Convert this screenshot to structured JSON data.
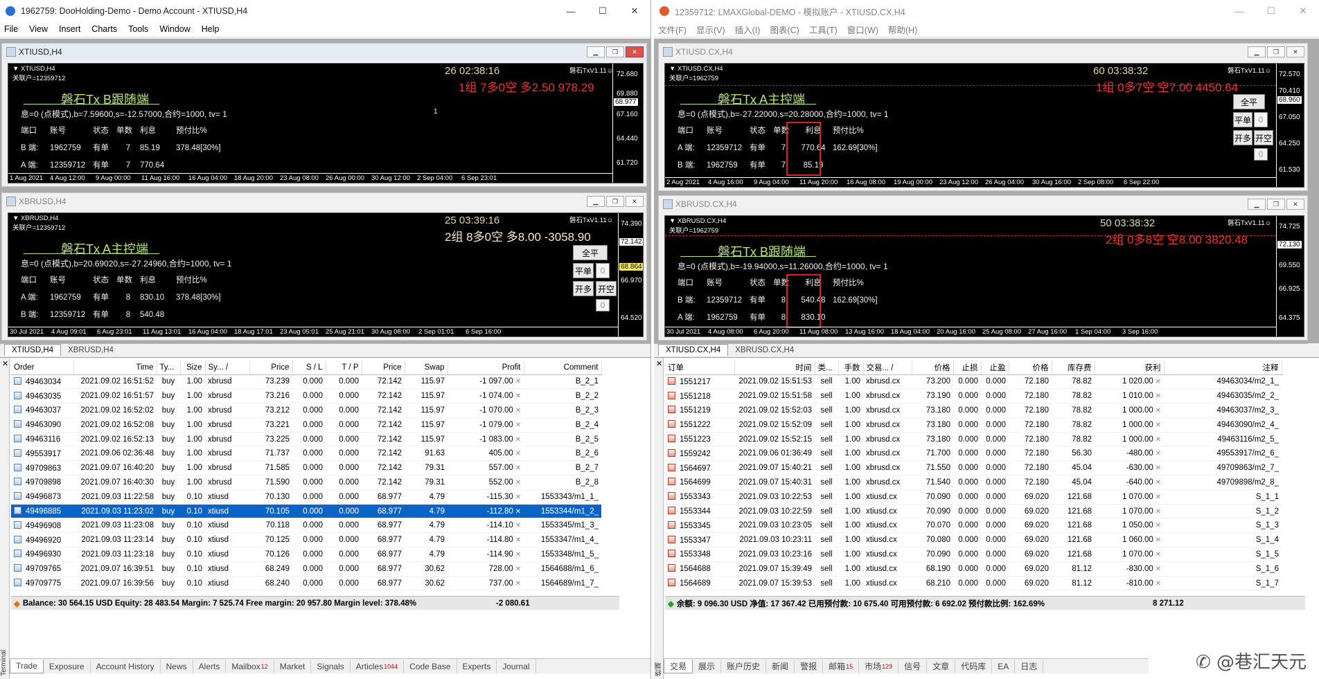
{
  "left": {
    "title": "1962759: DooHolding-Demo - Demo Account - XTIUSD,H4",
    "title_controls": [
      "—",
      "☐",
      "✕"
    ],
    "menu": [
      "File",
      "View",
      "Insert",
      "Charts",
      "Tools",
      "Window",
      "Help"
    ],
    "chart1": {
      "window_title": "XTIUSD,H4",
      "symbol": "▼ XTIUSD,H4",
      "account": "关联户=12359712",
      "version": "磐石TxV1.11☺",
      "timer": "26    02:38:16",
      "summary": "1组 7多0空 多2.50 978.29",
      "title_text": "磐石Tx B跟随端",
      "params": "息=0 (点模式),b=7.59600,s=-12.57000,合约=1000, tv= 1",
      "hdr": {
        "c1": "端口",
        "c2": "账号",
        "c3": "状态",
        "c4": "单数",
        "c5": "利息",
        "c6": "预付比%"
      },
      "row1": {
        "c1": "B 端:",
        "c2": "1962759",
        "c3": "有单",
        "c4": "7",
        "c5": "85.19",
        "c6": "378.48[30%]"
      },
      "row2": {
        "c1": "A 端:",
        "c2": "12359712",
        "c3": "有单",
        "c4": "7",
        "c5": "770.64"
      },
      "mark": "1",
      "prices": [
        "72.680",
        "69.880",
        "68.977",
        "67.160",
        "64.440",
        "61.720"
      ],
      "dates": [
        "1 Aug 2021",
        "4 Aug 12:00",
        "9 Aug 00:00",
        "11 Aug 16:00",
        "16 Aug 04:00",
        "18 Aug 20:00",
        "23 Aug 08:00",
        "26 Aug 00:00",
        "30 Aug 12:00",
        "2 Sep 04:00",
        "6 Sep 23:01"
      ]
    },
    "chart2": {
      "window_title": "XBRUSD,H4",
      "symbol": "▼ XBRUSD,H4",
      "account": "关联户=12359712",
      "version": "磐石TxV1.11☺",
      "timer": "25    03:39:16",
      "summary": "2组 8多0空 多8.00 -3058.90",
      "title_text": "磐石Tx A主控端",
      "params": "息=0 (点模式),b=20.69020,s=-27.24960,合约=1000, tv= 1",
      "hdr": {
        "c1": "端口",
        "c2": "账号",
        "c3": "状态",
        "c4": "单数",
        "c5": "利息",
        "c6": "预付比%"
      },
      "row1": {
        "c1": "A 端:",
        "c2": "1962759",
        "c3": "有单",
        "c4": "8",
        "c5": "830.10",
        "c6": "378.48[30%]"
      },
      "row2": {
        "c1": "B 端:",
        "c2": "12359712",
        "c3": "有单",
        "c4": "8",
        "c5": "540.48"
      },
      "prices": [
        "74.390",
        "72.142",
        "68.864",
        "66.970",
        "64.520"
      ],
      "dates": [
        "30 Jul 2021",
        "4 Aug 09:01",
        "6 Aug 23:01",
        "11 Aug 13:01",
        "16 Aug 04:00",
        "18 Aug 17:01",
        "23 Aug 05:01",
        "25 Aug 21:01",
        "30 Aug 08:00",
        "2 Sep 01:01",
        "6 Sep 16:00"
      ],
      "btn_all": "全平",
      "btn_flat": "平单",
      "btn_zero": "0",
      "btn_long": "开多",
      "btn_short": "开空"
    },
    "chart_tabs": [
      "XTIUSD,H4",
      "XBRUSD,H4"
    ],
    "terminal": {
      "side_label": "Terminal",
      "headers": [
        "Order",
        "Time",
        "Ty...",
        "Size",
        "Sy... /",
        "Price",
        "S / L",
        "T / P",
        "Price",
        "Swap",
        "Profit",
        "Comment"
      ],
      "rows": [
        [
          "49463034",
          "2021.09.02 16:51:52",
          "buy",
          "1.00",
          "xbrusd",
          "73.239",
          "0.000",
          "0.000",
          "72.142",
          "115.97",
          "-1 097.00",
          "B_2_1"
        ],
        [
          "49463035",
          "2021.09.02 16:51:57",
          "buy",
          "1.00",
          "xbrusd",
          "73.216",
          "0.000",
          "0.000",
          "72.142",
          "115.97",
          "-1 074.00",
          "B_2_2"
        ],
        [
          "49463037",
          "2021.09.02 16:52:02",
          "buy",
          "1.00",
          "xbrusd",
          "73.212",
          "0.000",
          "0.000",
          "72.142",
          "115.97",
          "-1 070.00",
          "B_2_3"
        ],
        [
          "49463090",
          "2021.09.02 16:52:08",
          "buy",
          "1.00",
          "xbrusd",
          "73.221",
          "0.000",
          "0.000",
          "72.142",
          "115.97",
          "-1 079.00",
          "B_2_4"
        ],
        [
          "49463116",
          "2021.09.02 16:52:13",
          "buy",
          "1.00",
          "xbrusd",
          "73.225",
          "0.000",
          "0.000",
          "72.142",
          "115.97",
          "-1 083.00",
          "B_2_5"
        ],
        [
          "49553917",
          "2021.09.06 02:36:48",
          "buy",
          "1.00",
          "xbrusd",
          "71.737",
          "0.000",
          "0.000",
          "72.142",
          "91.63",
          "405.00",
          "B_2_6"
        ],
        [
          "49709863",
          "2021.09.07 16:40:20",
          "buy",
          "1.00",
          "xbrusd",
          "71.585",
          "0.000",
          "0.000",
          "72.142",
          "79.31",
          "557.00",
          "B_2_7"
        ],
        [
          "49709898",
          "2021.09.07 16:40:30",
          "buy",
          "1.00",
          "xbrusd",
          "71.590",
          "0.000",
          "0.000",
          "72.142",
          "79.31",
          "552.00",
          "B_2_8"
        ],
        [
          "49496873",
          "2021.09.03 11:22:58",
          "buy",
          "0.10",
          "xtiusd",
          "70.130",
          "0.000",
          "0.000",
          "68.977",
          "4.79",
          "-115.30",
          "1553343/m1_1_"
        ],
        [
          "49496885",
          "2021.09.03 11:23:02",
          "buy",
          "0.10",
          "xtiusd",
          "70.105",
          "0.000",
          "0.000",
          "68.977",
          "4.79",
          "-112.80",
          "1553344/m1_2_"
        ],
        [
          "49496908",
          "2021.09.03 11:23:08",
          "buy",
          "0.10",
          "xtiusd",
          "70.118",
          "0.000",
          "0.000",
          "68.977",
          "4.79",
          "-114.10",
          "1553345/m1_3_"
        ],
        [
          "49496920",
          "2021.09.03 11:23:14",
          "buy",
          "0.10",
          "xtiusd",
          "70.125",
          "0.000",
          "0.000",
          "68.977",
          "4.79",
          "-114.80",
          "1553347/m1_4_"
        ],
        [
          "49496930",
          "2021.09.03 11:23:18",
          "buy",
          "0.10",
          "xtiusd",
          "70.126",
          "0.000",
          "0.000",
          "68.977",
          "4.79",
          "-114.90",
          "1553348/m1_5_"
        ],
        [
          "49709765",
          "2021.09.07 16:39:51",
          "buy",
          "0.10",
          "xtiusd",
          "68.249",
          "0.000",
          "0.000",
          "68.977",
          "30.62",
          "728.00",
          "1564688/m1_6_"
        ],
        [
          "49709775",
          "2021.09.07 16:39:56",
          "buy",
          "0.10",
          "xtiusd",
          "68.240",
          "0.000",
          "0.000",
          "68.977",
          "30.62",
          "737.00",
          "1564689/m1_7_"
        ]
      ],
      "selected_row": 9,
      "balance_line": "Balance: 30 564.15 USD  Equity: 28 483.54  Margin: 7 525.74  Free margin: 20 957.80  Margin level: 378.48%",
      "balance_profit": "-2 080.61",
      "tabs": [
        {
          "label": "Trade",
          "badge": ""
        },
        {
          "label": "Exposure",
          "badge": ""
        },
        {
          "label": "Account History",
          "badge": ""
        },
        {
          "label": "News",
          "badge": ""
        },
        {
          "label": "Alerts",
          "badge": ""
        },
        {
          "label": "Mailbox",
          "badge": "12"
        },
        {
          "label": "Market",
          "badge": ""
        },
        {
          "label": "Signals",
          "badge": ""
        },
        {
          "label": "Articles",
          "badge": "1044"
        },
        {
          "label": "Code Base",
          "badge": ""
        },
        {
          "label": "Experts",
          "badge": ""
        },
        {
          "label": "Journal",
          "badge": ""
        }
      ]
    }
  },
  "right": {
    "title": "12359712: LMAXGlobal-DEMO - 模拟账户 - XTIUSD.CX,H4",
    "title_controls": [
      "—",
      "☐",
      "✕"
    ],
    "menu": [
      "文件(F)",
      "显示(V)",
      "插入(I)",
      "图表(C)",
      "工具(T)",
      "窗口(W)",
      "帮助(H)"
    ],
    "chart1": {
      "window_title": "XTIUSD.CX,H4",
      "symbol": "▼ XTIUSD.CX,H4",
      "account": "关联户=1962759",
      "version": "磐石TxV1.11☺",
      "timer": "60    03:38:32",
      "summary": "1组 0多7空 空7.00 4450.64",
      "title_text": "磐石Tx A主控端",
      "params": "息=0 (点模式),b=-27.22000,s=20.28000,合约=1000, tv= 1",
      "hdr": {
        "c1": "端口",
        "c2": "账号",
        "c3": "状态",
        "c4": "单数",
        "c5": "利息",
        "c6": "预付比%"
      },
      "row1": {
        "c1": "A 端:",
        "c2": "12359712",
        "c3": "有单",
        "c4": "7",
        "c5": "770.64",
        "c6": "162.69[30%]"
      },
      "row2": {
        "c1": "B 端:",
        "c2": "1962759",
        "c3": "有单",
        "c4": "7",
        "c5": "85.19"
      },
      "prices": [
        "72.570",
        "70.410",
        "68.960",
        "67.050",
        "64.250",
        "61.530"
      ],
      "dates": [
        "2 Aug 2021",
        "4 Aug 16:00",
        "9 Aug 04:00",
        "11 Aug 20:00",
        "16 Aug 08:00",
        "19 Aug 00:00",
        "23 Aug 12:00",
        "26 Aug 04:00",
        "30 Aug 16:00",
        "2 Sep 08:00",
        "6 Sep 22:00"
      ],
      "btn_all": "全平",
      "btn_flat": "平单",
      "btn_zero": "0",
      "btn_long": "开多",
      "btn_short": "开空"
    },
    "chart2": {
      "window_title": "XBRUSD.CX,H4",
      "symbol": "▼ XBRUSD.CX,H4",
      "account": "关联户=1962759",
      "version": "磐石TxV1.11☺",
      "timer": "50    03:38:32",
      "summary": "2组 0多8空 空8.00 3820.48",
      "title_text": "磐石Tx B跟随端",
      "params": "息=0 (点模式),b=-19.94000,s=11.26000,合约=1000, tv= 1",
      "hdr": {
        "c1": "端口",
        "c2": "账号",
        "c3": "状态",
        "c4": "单数",
        "c5": "利息",
        "c6": "预付比%"
      },
      "row1": {
        "c1": "B 端:",
        "c2": "12359712",
        "c3": "有单",
        "c4": "8",
        "c5": "540.48",
        "c6": "162.69[30%]"
      },
      "row2": {
        "c1": "A 端:",
        "c2": "1962759",
        "c3": "有单",
        "c4": "8",
        "c5": "830.10"
      },
      "prices": [
        "74.725",
        "72.130",
        "69.550",
        "66.925",
        "64.375"
      ],
      "dates": [
        "30 Jul 2021",
        "4 Aug 08:00",
        "6 Aug 20:00",
        "11 Aug 08:00",
        "13 Aug 16:00",
        "18 Aug 04:00",
        "20 Aug 16:00",
        "25 Aug 08:00",
        "27 Aug 16:00",
        "1 Sep 04:00",
        "3 Sep 16:00"
      ]
    },
    "chart_tabs": [
      "XTIUSD.CX,H4",
      "XBRUSD.CX,H4"
    ],
    "terminal": {
      "side_label": "终端",
      "headers": [
        "订单",
        "时间",
        "类...",
        "手数",
        "交易... /",
        "价格",
        "止损",
        "止盈",
        "价格",
        "库存费",
        "获利",
        "注释"
      ],
      "rows": [
        [
          "1551217",
          "2021.09.02 15:51:53",
          "sell",
          "1.00",
          "xbrusd.cx",
          "73.200",
          "0.000",
          "0.000",
          "72.180",
          "78.82",
          "1 020.00",
          "49463034/m2_1_"
        ],
        [
          "1551218",
          "2021.09.02 15:51:58",
          "sell",
          "1.00",
          "xbrusd.cx",
          "73.190",
          "0.000",
          "0.000",
          "72.180",
          "78.82",
          "1 010.00",
          "49463035/m2_2_"
        ],
        [
          "1551219",
          "2021.09.02 15:52:03",
          "sell",
          "1.00",
          "xbrusd.cx",
          "73.180",
          "0.000",
          "0.000",
          "72.180",
          "78.82",
          "1 000.00",
          "49463037/m2_3_"
        ],
        [
          "1551222",
          "2021.09.02 15:52:09",
          "sell",
          "1.00",
          "xbrusd.cx",
          "73.180",
          "0.000",
          "0.000",
          "72.180",
          "78.82",
          "1 000.00",
          "49463090/m2_4_"
        ],
        [
          "1551223",
          "2021.09.02 15:52:15",
          "sell",
          "1.00",
          "xbrusd.cx",
          "73.180",
          "0.000",
          "0.000",
          "72.180",
          "78.82",
          "1 000.00",
          "49463116/m2_5_"
        ],
        [
          "1559242",
          "2021.09.06 01:36:49",
          "sell",
          "1.00",
          "xbrusd.cx",
          "71.700",
          "0.000",
          "0.000",
          "72.180",
          "56.30",
          "-480.00",
          "49553917/m2_6_"
        ],
        [
          "1564697",
          "2021.09.07 15:40:21",
          "sell",
          "1.00",
          "xbrusd.cx",
          "71.550",
          "0.000",
          "0.000",
          "72.180",
          "45.04",
          "-630.00",
          "49709863/m2_7_"
        ],
        [
          "1564699",
          "2021.09.07 15:40:31",
          "sell",
          "1.00",
          "xbrusd.cx",
          "71.540",
          "0.000",
          "0.000",
          "72.180",
          "45.04",
          "-640.00",
          "49709898/m2_8_"
        ],
        [
          "1553343",
          "2021.09.03 10:22:53",
          "sell",
          "1.00",
          "xtiusd.cx",
          "70.090",
          "0.000",
          "0.000",
          "69.020",
          "121.68",
          "1 070.00",
          "S_1_1"
        ],
        [
          "1553344",
          "2021.09.03 10:22:59",
          "sell",
          "1.00",
          "xtiusd.cx",
          "70.090",
          "0.000",
          "0.000",
          "69.020",
          "121.68",
          "1 070.00",
          "S_1_2"
        ],
        [
          "1553345",
          "2021.09.03 10:23:05",
          "sell",
          "1.00",
          "xtiusd.cx",
          "70.070",
          "0.000",
          "0.000",
          "69.020",
          "121.68",
          "1 050.00",
          "S_1_3"
        ],
        [
          "1553347",
          "2021.09.03 10:23:11",
          "sell",
          "1.00",
          "xtiusd.cx",
          "70.080",
          "0.000",
          "0.000",
          "69.020",
          "121.68",
          "1 060.00",
          "S_1_4"
        ],
        [
          "1553348",
          "2021.09.03 10:23:16",
          "sell",
          "1.00",
          "xtiusd.cx",
          "70.090",
          "0.000",
          "0.000",
          "69.020",
          "121.68",
          "1 070.00",
          "S_1_5"
        ],
        [
          "1564688",
          "2021.09.07 15:39:49",
          "sell",
          "1.00",
          "xtiusd.cx",
          "68.190",
          "0.000",
          "0.000",
          "69.020",
          "81.12",
          "-830.00",
          "S_1_6"
        ],
        [
          "1564689",
          "2021.09.07 15:39:53",
          "sell",
          "1.00",
          "xtiusd.cx",
          "68.210",
          "0.000",
          "0.000",
          "69.020",
          "81.12",
          "-810.00",
          "S_1_7"
        ]
      ],
      "balance_line": "余额: 9 096.30 USD  净值: 17 367.42  已用预付款: 10 675.40  可用预付款: 6 692.02  预付款比例: 162.69%",
      "balance_profit": "8 271.12",
      "tabs": [
        {
          "label": "交易",
          "badge": ""
        },
        {
          "label": "展示",
          "badge": ""
        },
        {
          "label": "账户历史",
          "badge": ""
        },
        {
          "label": "新闻",
          "badge": ""
        },
        {
          "label": "警报",
          "badge": ""
        },
        {
          "label": "邮箱",
          "badge": "15"
        },
        {
          "label": "市场",
          "badge": "129"
        },
        {
          "label": "信号",
          "badge": ""
        },
        {
          "label": "文章",
          "badge": ""
        },
        {
          "label": "代码库",
          "badge": ""
        },
        {
          "label": "EA",
          "badge": ""
        },
        {
          "label": "日志",
          "badge": ""
        }
      ]
    },
    "watermark": "✆ @巷汇天元"
  }
}
